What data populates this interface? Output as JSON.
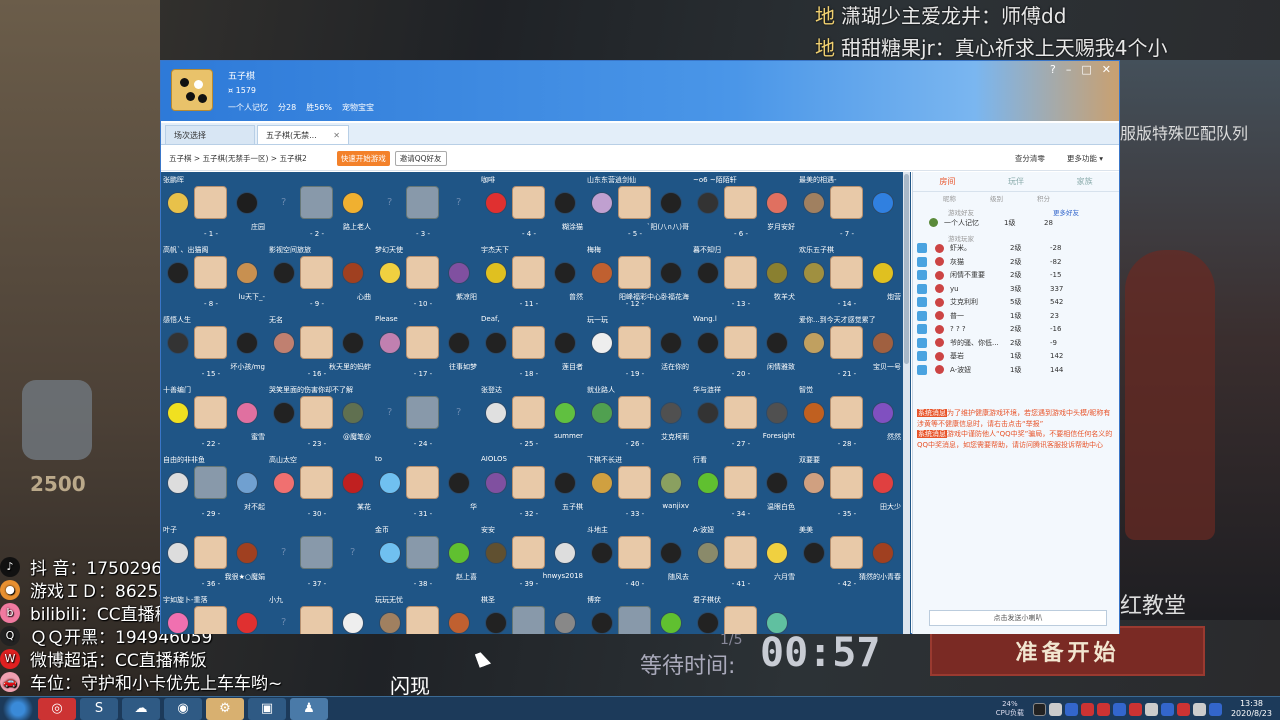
{
  "danmaku": [
    {
      "tag": "地",
      "text": "潇瑚少主爱龙井：师傅dd"
    },
    {
      "tag": "地",
      "text": "甜甜糖果jr：真心祈求上天赐我4个小"
    }
  ],
  "background": {
    "side_label": "服版特殊匹配队列",
    "church_label": "红教堂",
    "ready_button": "准备开始",
    "wait_label": "等待时间:",
    "timer": "00:57",
    "counter": "1/5",
    "flash_label": "闪现",
    "score": "2500"
  },
  "stream_overlay": [
    {
      "icon": "douyin",
      "text": "抖    音：1750296164"
    },
    {
      "icon": "game",
      "text": "游戏ＩＤ：86253981"
    },
    {
      "icon": "bilibili",
      "text": "bilibili：CC直播稀饭"
    },
    {
      "icon": "qq",
      "text": "ＱＱ开黑：194946059"
    },
    {
      "icon": "weibo",
      "text": "微博超话：CC直播稀饭"
    },
    {
      "icon": "car",
      "text": "车位：守护和小卡优先上车车哟~"
    }
  ],
  "window": {
    "game_title": "五子棋",
    "coins": "¤ 1579",
    "username": "一个人记忆",
    "points": "分28",
    "win_rate": "胜56%",
    "pet": "宠物宝宝",
    "buttons": [
      "?",
      "–",
      "□",
      "✕"
    ]
  },
  "tabs": [
    {
      "label": "场次选择"
    },
    {
      "label": "五子棋(无禁...",
      "close": "✕"
    }
  ],
  "toolbar": {
    "breadcrumb": "五子棋 > 五子棋(无禁手一区) > 五子棋2",
    "quick_start": "快速开始游戏",
    "invite": "邀请QQ好友",
    "settings": "查分清零",
    "more": "更多功能 ▾"
  },
  "tables": [
    {
      "num": "- 1 -",
      "top": "张鹏晖",
      "bot": "庄园",
      "l": "#e8c14a",
      "r": "#1e1e1e",
      "empty": false
    },
    {
      "num": "- 2 -",
      "top": "",
      "bot": "路上老人",
      "l": "",
      "r": "#f0b030",
      "empty": true
    },
    {
      "num": "- 3 -",
      "top": "",
      "bot": "",
      "l": "",
      "r": "",
      "empty": true
    },
    {
      "num": "- 4 -",
      "top": "咖啡",
      "bot": "糊涂猫",
      "l": "#e03030",
      "r": "#222",
      "empty": false
    },
    {
      "num": "- 5 -",
      "top": "山东东营逍剑仙",
      "bot": "`阳(八∩八)哥",
      "l": "#c0a0d0",
      "r": "#222",
      "empty": false
    },
    {
      "num": "- 6 -",
      "top": "~o6 ~陌陌轩",
      "bot": "岁月安好",
      "l": "#333",
      "r": "#e07060",
      "empty": false
    },
    {
      "num": "- 7 -",
      "top": "最美的相遇-",
      "bot": "",
      "l": "#a08060",
      "r": "#3080e0",
      "empty": false
    },
    {
      "num": "- 8 -",
      "top": "高帆`、出猫阁",
      "bot": "lu天下_-",
      "l": "#222",
      "r": "#c89050",
      "empty": false
    },
    {
      "num": "- 9 -",
      "top": "影视空间旅旅",
      "bot": "心曲",
      "l": "#222",
      "r": "#a04020",
      "empty": false
    },
    {
      "num": "- 10 -",
      "top": "梦幻天使",
      "bot": "紫凉阳",
      "l": "#f0d040",
      "r": "#8050a0",
      "empty": false
    },
    {
      "num": "- 11 -",
      "top": "宇杰天下",
      "bot": "曾然",
      "l": "#e0c020",
      "r": "#222",
      "empty": false
    },
    {
      "num": "- 12 -",
      "top": "梅梅",
      "bot": "阳峰福彩中心卧福花海",
      "l": "#c06030",
      "r": "#222",
      "empty": false
    },
    {
      "num": "- 13 -",
      "top": "暮不知归",
      "bot": "牧羊犬",
      "l": "#222",
      "r": "#8a8030",
      "empty": false
    },
    {
      "num": "- 14 -",
      "top": "欢乐五子棋",
      "bot": "炮营",
      "l": "#a09040",
      "r": "#e0c020",
      "empty": false
    },
    {
      "num": "- 15 -",
      "top": "感悟人生",
      "bot": "坏小孩/mg",
      "l": "#333",
      "r": "#222",
      "empty": false
    },
    {
      "num": "- 16 -",
      "top": "无名",
      "bot": "秋天里的蚂蚱",
      "l": "#c08070",
      "r": "#222",
      "empty": false
    },
    {
      "num": "- 17 -",
      "top": "Please",
      "bot": "往事如梦",
      "l": "#c080b0",
      "r": "#222",
      "empty": false
    },
    {
      "num": "- 18 -",
      "top": "Deaf,",
      "bot": "莲目者",
      "l": "#222",
      "r": "#222",
      "empty": false
    },
    {
      "num": "- 19 -",
      "top": "玩一玩",
      "bot": "活在你的",
      "l": "#eee",
      "r": "#222",
      "empty": false
    },
    {
      "num": "- 20 -",
      "top": "Wang.l",
      "bot": "闲情雅致",
      "l": "#222",
      "r": "#222",
      "empty": false
    },
    {
      "num": "- 21 -",
      "top": "爱你...到今天才感觉累了",
      "bot": "宝贝一号",
      "l": "#c0a060",
      "r": "#a06040",
      "empty": false
    },
    {
      "num": "- 22 -",
      "top": "十善编门",
      "bot": "蜜雪",
      "l": "#f0e020",
      "r": "#e070a0",
      "empty": false
    },
    {
      "num": "- 23 -",
      "top": "哭笑里面的伤害你却不了解",
      "bot": "@魔笔@",
      "l": "#222",
      "r": "#607050",
      "empty": false
    },
    {
      "num": "- 24 -",
      "top": "",
      "bot": "",
      "l": "",
      "r": "",
      "empty": true
    },
    {
      "num": "- 25 -",
      "top": "张登达",
      "bot": "summer",
      "l": "#e0e0e0",
      "r": "#60c040",
      "empty": false
    },
    {
      "num": "- 26 -",
      "top": "就业路人",
      "bot": "艾克柯莉",
      "l": "#50a050",
      "r": "#505050",
      "empty": false
    },
    {
      "num": "- 27 -",
      "top": "华与涟祥",
      "bot": "Foresight",
      "l": "#333",
      "r": "#505050",
      "empty": false
    },
    {
      "num": "- 28 -",
      "top": "智觉",
      "bot": "然然",
      "l": "#c06020",
      "r": "#8050c0",
      "empty": false
    },
    {
      "num": "- 29 -",
      "top": "自由的非非鱼",
      "bot": "对不起",
      "l": "#ddd",
      "r": "#70a0d0",
      "empty": true
    },
    {
      "num": "- 30 -",
      "top": "高山太空",
      "bot": "某花",
      "l": "#f07070",
      "r": "#c02020",
      "empty": false
    },
    {
      "num": "- 31 -",
      "top": "to",
      "bot": "华",
      "l": "#70c0f0",
      "r": "#222",
      "empty": false
    },
    {
      "num": "- 32 -",
      "top": "AIOLOS",
      "bot": "五子棋",
      "l": "#8050a0",
      "r": "#222",
      "empty": false
    },
    {
      "num": "- 33 -",
      "top": "下棋不长进",
      "bot": "wanjixv",
      "l": "#d0a040",
      "r": "#8aa060",
      "empty": false
    },
    {
      "num": "- 34 -",
      "top": "行看",
      "bot": "温眼白色",
      "l": "#60c030",
      "r": "#222",
      "empty": false
    },
    {
      "num": "- 35 -",
      "top": "双要要",
      "bot": "田大少",
      "l": "#d0a080",
      "r": "#e04040",
      "empty": false
    },
    {
      "num": "- 36 -",
      "top": "叶子",
      "bot": "我很★○魔娟",
      "l": "#ddd",
      "r": "#a04020",
      "empty": false
    },
    {
      "num": "- 37 -",
      "top": "",
      "bot": "",
      "l": "",
      "r": "",
      "empty": true
    },
    {
      "num": "- 38 -",
      "top": "金币",
      "bot": "赵上喜",
      "l": "#70c0f0",
      "r": "#60c030",
      "empty": true
    },
    {
      "num": "- 39 -",
      "top": "安安",
      "bot": "hnwys2018",
      "l": "#605030",
      "r": "#ddd",
      "empty": false
    },
    {
      "num": "- 40 -",
      "top": "斗地主",
      "bot": "随风去",
      "l": "#222",
      "r": "#222",
      "empty": false
    },
    {
      "num": "- 41 -",
      "top": "A-波妞",
      "bot": "六月雪",
      "l": "#8a8a6a",
      "r": "#f0d040",
      "empty": false
    },
    {
      "num": "- 42 -",
      "top": "美美",
      "bot": "猜然的小青春",
      "l": "#222",
      "r": "#a04020",
      "empty": false
    },
    {
      "num": "",
      "top": "宇如旋卜-重落",
      "bot": "",
      "l": "#f070b0",
      "r": "#e03030",
      "empty": false
    },
    {
      "num": "",
      "top": "小九",
      "bot": "",
      "l": "",
      "r": "#eee",
      "empty": false
    },
    {
      "num": "",
      "top": "玩玩无忧",
      "bot": "",
      "l": "#a08060",
      "r": "#c06030",
      "empty": false
    },
    {
      "num": "",
      "top": "棋圣",
      "bot": "",
      "l": "#222",
      "r": "#888",
      "empty": true
    },
    {
      "num": "",
      "top": "博弈",
      "bot": "",
      "l": "#222",
      "r": "#60c030",
      "empty": true
    },
    {
      "num": "",
      "top": "君子棋伏",
      "bot": "",
      "l": "#222",
      "r": "#60c0a0",
      "empty": false
    }
  ],
  "right_pane": {
    "tabs": [
      "房间",
      "玩伴",
      "家族"
    ],
    "columns": [
      "昵称",
      "级别",
      "积分"
    ],
    "friends_section": "游戏好友",
    "more_friends": "更多好友",
    "friend": {
      "name": "一个人记忆",
      "level": "1级",
      "score": "28"
    },
    "players_section": "游戏玩家",
    "players": [
      {
        "name": "虾米。",
        "level": "2级",
        "score": "-28"
      },
      {
        "name": "灰猫",
        "level": "2级",
        "score": "-82"
      },
      {
        "name": "闲情不重要",
        "level": "2级",
        "score": "-15"
      },
      {
        "name": "yu",
        "level": "3级",
        "score": "337"
      },
      {
        "name": "艾克利利",
        "level": "5级",
        "score": "542"
      },
      {
        "name": "普一",
        "level": "1级",
        "score": "23"
      },
      {
        "name": "? ? ?",
        "level": "2级",
        "score": "-16"
      },
      {
        "name": "爷的骚、你低...",
        "level": "2级",
        "score": "-9"
      },
      {
        "name": "基岩",
        "level": "1级",
        "score": "142"
      },
      {
        "name": "A-波妞",
        "level": "1级",
        "score": "144"
      }
    ],
    "notice1_tag": "系统消息",
    "notice1": "为了维护健康游戏环境，若您遇到游戏中头模/昵称有涉黄等不健康信息时，请右击点击“举报”",
    "notice2_tag": "系统消息",
    "notice2": "游戏中谨防他人“QQ中奖”骗局，不要相信任何名义的QQ中奖消息，如您需要帮助，请访问腾讯客服投诉帮助中心",
    "chat_placeholder": "点击发送小喇叭"
  },
  "taskbar": {
    "cpu": "24%",
    "cpu_label": "CPU负载",
    "time": "13:38",
    "date": "2020/8/23"
  }
}
